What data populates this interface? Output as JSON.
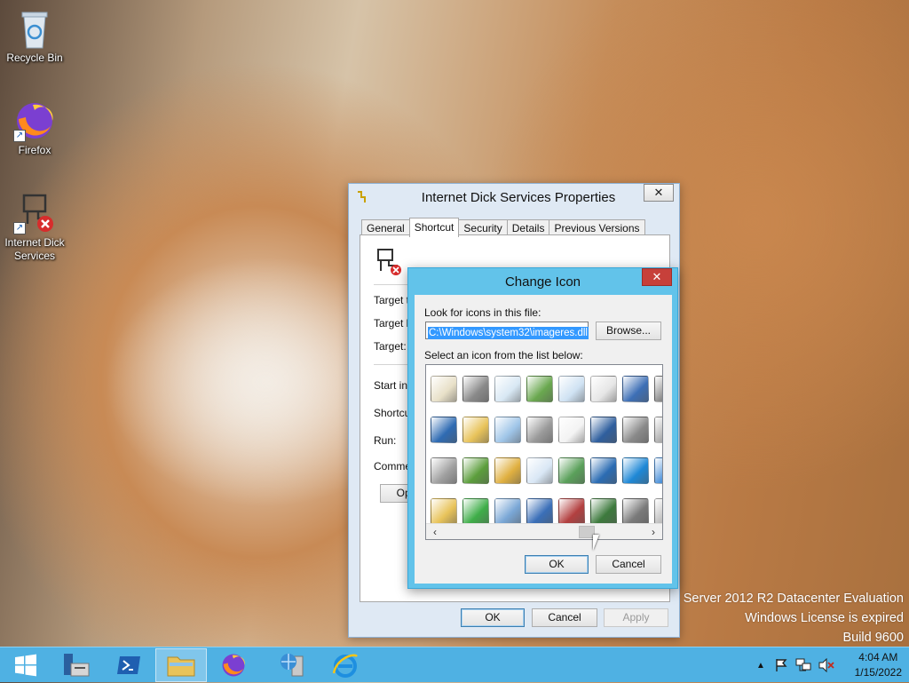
{
  "desktop": {
    "icons": [
      {
        "label": "Recycle Bin"
      },
      {
        "label": "Firefox"
      },
      {
        "label": "Internet Dick Services"
      }
    ]
  },
  "watermark": {
    "line1": "Server 2012 R2 Datacenter Evaluation",
    "line2": "Windows License is expired",
    "line3": "Build 9600"
  },
  "properties": {
    "title": "Internet Dick Services Properties",
    "close_label": "✕",
    "tabs": [
      {
        "label": "General",
        "active": false
      },
      {
        "label": "Shortcut",
        "active": true
      },
      {
        "label": "Security",
        "active": false
      },
      {
        "label": "Details",
        "active": false
      },
      {
        "label": "Previous Versions",
        "active": false
      }
    ],
    "fields": {
      "target_type": "Target ty",
      "target_location": "Target lo",
      "target": "Target:",
      "start_in": "Start in:",
      "shortcut_key": "Shortcut",
      "run": "Run:",
      "comment": "Commen"
    },
    "open_button": "Ope",
    "ok": "OK",
    "cancel": "Cancel",
    "apply": "Apply"
  },
  "change_icon": {
    "title": "Change Icon",
    "close_label": "✕",
    "look_label": "Look for icons in this file:",
    "path_value": "C:\\Windows\\system32\\imageres.dll",
    "browse": "Browse...",
    "select_label": "Select an icon from the list below:",
    "ok": "OK",
    "cancel": "Cancel",
    "icons": [
      {
        "name": "document-edit-icon",
        "color": "#e8e0c8"
      },
      {
        "name": "pushpin-icon",
        "color": "#8a8a8a"
      },
      {
        "name": "checklist-undo-icon",
        "color": "#d8e8f4"
      },
      {
        "name": "media-play-icon",
        "color": "#6aa84f"
      },
      {
        "name": "table-columns-icon",
        "color": "#cfe2f3"
      },
      {
        "name": "list-view-icon",
        "color": "#e6e6e6"
      },
      {
        "name": "computer-tools-icon",
        "color": "#3d6fb6"
      },
      {
        "name": "partial-icon",
        "color": "#888888"
      },
      {
        "name": "user-computer-icon",
        "color": "#2f6bb3"
      },
      {
        "name": "folder-check-icon",
        "color": "#e8c35a"
      },
      {
        "name": "window-pane-icon",
        "color": "#9fc5e8"
      },
      {
        "name": "printer-icon",
        "color": "#9a9a9a"
      },
      {
        "name": "document-check-icon",
        "color": "#f3f3f3"
      },
      {
        "name": "monitor-phone-icon",
        "color": "#2f5f9e"
      },
      {
        "name": "printer-check-icon",
        "color": "#8a8a8a"
      },
      {
        "name": "partial-icon-2",
        "color": "#aaaaaa"
      },
      {
        "name": "fax-icon",
        "color": "#a0a0a0"
      },
      {
        "name": "users-check-icon",
        "color": "#5c9e3c"
      },
      {
        "name": "key-icon",
        "color": "#e0b040"
      },
      {
        "name": "checklist-icon",
        "color": "#d9e7f5"
      },
      {
        "name": "clock-error-icon",
        "color": "#5aa05a"
      },
      {
        "name": "powershell-icon",
        "color": "#2b6cb3"
      },
      {
        "name": "windows-pin-icon",
        "color": "#1e88d6"
      },
      {
        "name": "partial-icon-3",
        "color": "#4a90d9"
      },
      {
        "name": "folder-clock-icon",
        "color": "#e8c35a"
      },
      {
        "name": "blocks-icon",
        "color": "#3fae49"
      },
      {
        "name": "list-lines-icon",
        "color": "#7aa7d6"
      },
      {
        "name": "network-users-icon",
        "color": "#3a6fb8"
      },
      {
        "name": "user-block-icon",
        "color": "#b34040"
      },
      {
        "name": "user-terminal-icon",
        "color": "#3d7a3d"
      },
      {
        "name": "media-drive-icon",
        "color": "#7a7a7a"
      },
      {
        "name": "partial-icon-4",
        "color": "#bbbbbb"
      }
    ]
  },
  "taskbar": {
    "clock_time": "4:04 AM",
    "clock_date": "1/15/2022"
  }
}
